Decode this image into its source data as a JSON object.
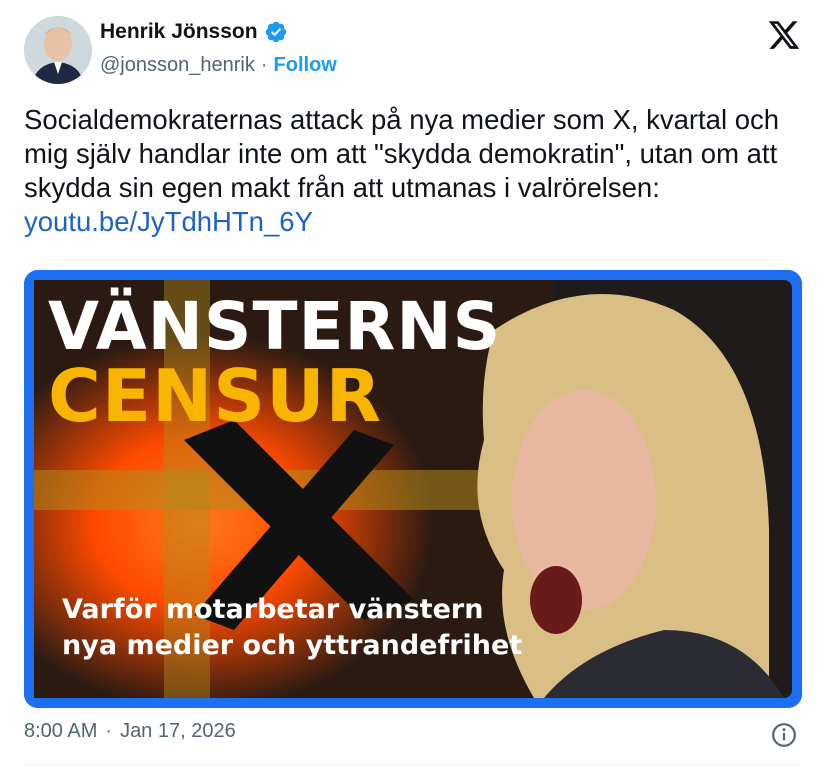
{
  "author": {
    "name": "Henrik Jönsson",
    "handle": "@jonsson_henrik",
    "separator": "·",
    "follow_label": "Follow"
  },
  "tweet": {
    "text": "Socialdemokraternas attack på nya medier som X, kvartal och mig själv handlar inte om att \"skydda demokratin\", utan om att skydda sin egen makt från att utmanas i valrörelsen: ",
    "link": "youtu.be/JyTdhHTn_6Y"
  },
  "media": {
    "title_line1": "VÄNSTERNS",
    "title_line2": "CENSUR",
    "subtitle_line1": "Varför motarbetar vänstern",
    "subtitle_line2": "nya medier och yttrandefrihet",
    "colors": {
      "frame": "#1b6ff0",
      "accent": "#f7b500",
      "glow": "#ff5a00"
    }
  },
  "footer": {
    "time": "8:00 AM",
    "separator": "·",
    "date": "Jan 17, 2026"
  },
  "icons": [
    "verified-badge-icon",
    "x-logo-icon",
    "info-icon"
  ],
  "colors": {
    "link": "#1d9bf0",
    "text": "#0f1419",
    "muted": "#536471"
  }
}
